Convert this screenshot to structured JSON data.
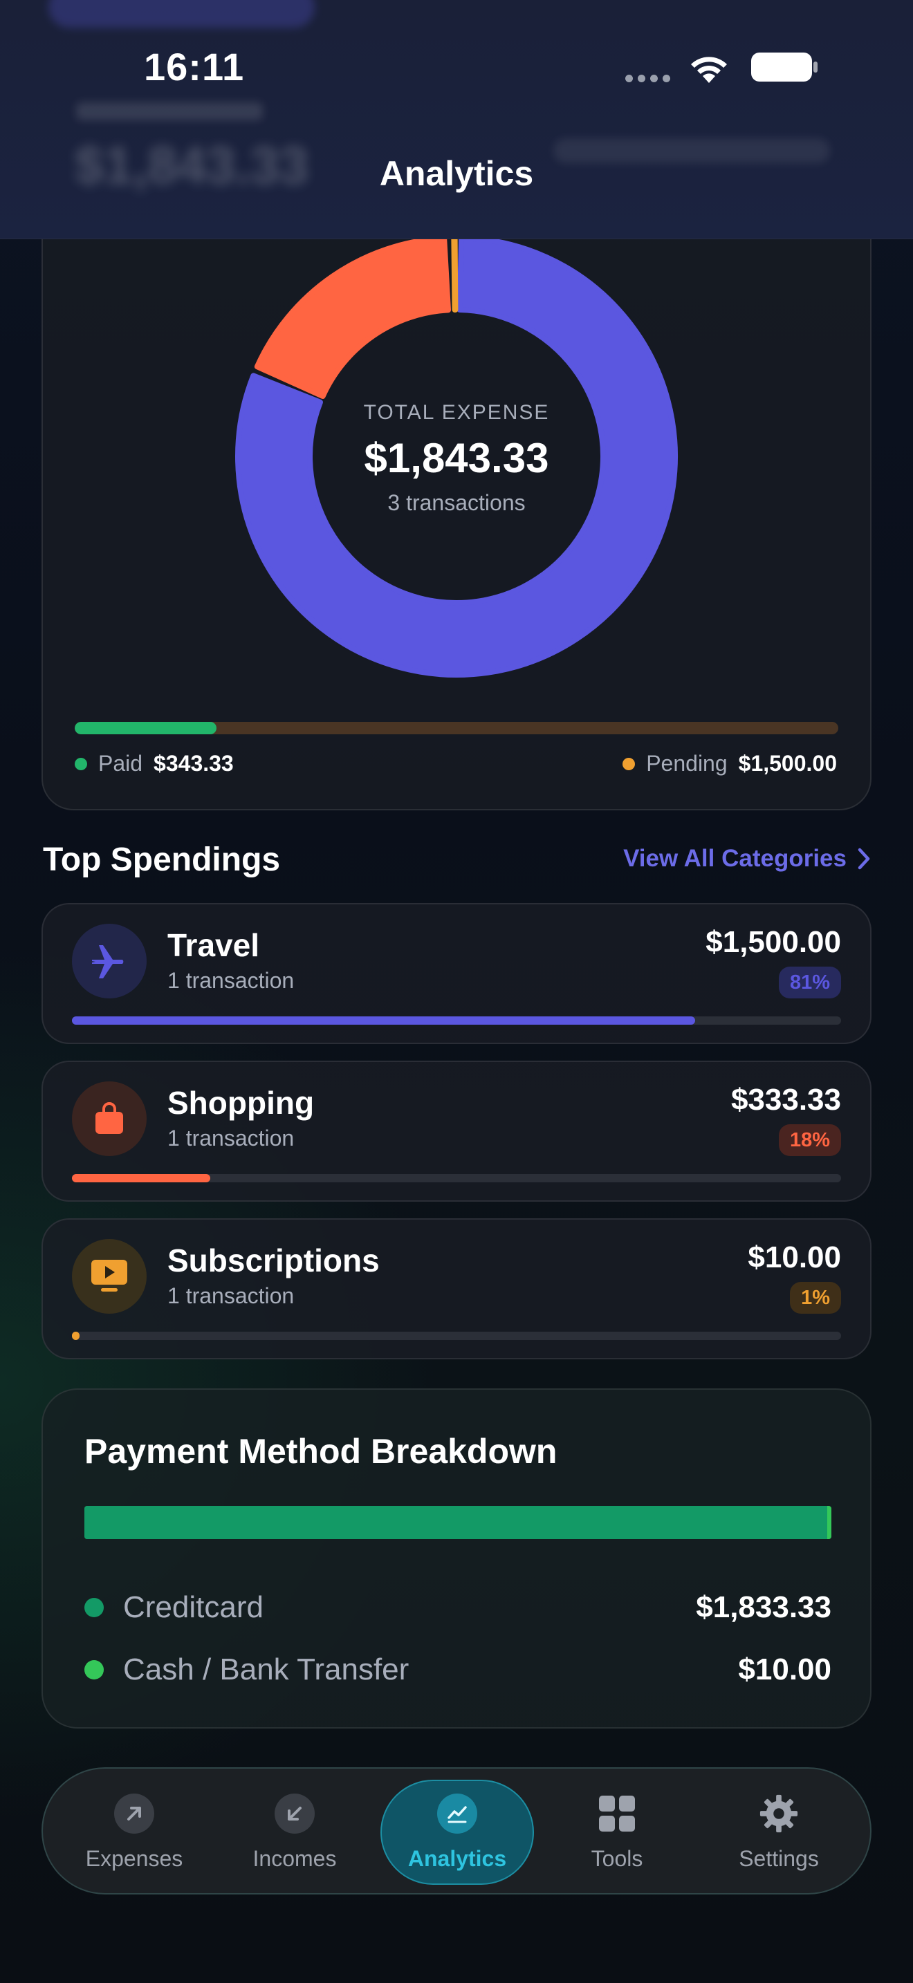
{
  "status": {
    "time": "16:11"
  },
  "header": {
    "title": "Analytics"
  },
  "summary": {
    "label": "TOTAL EXPENSE",
    "amount": "$1,843.33",
    "transactions": "3 transactions",
    "paid_label": "Paid",
    "paid_value": "$343.33",
    "pending_label": "Pending",
    "pending_value": "$1,500.00",
    "paid_fraction": 0.186,
    "colors": {
      "paid": "#22b56a",
      "pending": "#f0a030"
    }
  },
  "chart_data": {
    "type": "pie",
    "title": "",
    "categories": [
      "Travel",
      "Shopping",
      "Subscriptions"
    ],
    "values": [
      1500.0,
      333.33,
      10.0
    ],
    "colors": [
      "#5b57e0",
      "#ff6542",
      "#f0a030"
    ]
  },
  "top_spendings": {
    "title": "Top Spendings",
    "view_all": "View All Categories",
    "items": [
      {
        "name": "Travel",
        "count": "1 transaction",
        "amount": "$1,500.00",
        "percent": "81%",
        "fraction": 0.81,
        "icon": "airplane-icon",
        "color": "#5b57e0",
        "badge_bg": "#272a5e",
        "icon_bg": "#22264a"
      },
      {
        "name": "Shopping",
        "count": "1 transaction",
        "amount": "$333.33",
        "percent": "18%",
        "fraction": 0.18,
        "icon": "shopping-bag-icon",
        "color": "#ff6542",
        "badge_bg": "#4a2420",
        "icon_bg": "#3a2420"
      },
      {
        "name": "Subscriptions",
        "count": "1 transaction",
        "amount": "$10.00",
        "percent": "1%",
        "fraction": 0.01,
        "icon": "play-screen-icon",
        "color": "#f0a030",
        "badge_bg": "#3f2f18",
        "icon_bg": "#38301c"
      }
    ]
  },
  "payment": {
    "title": "Payment Method Breakdown",
    "methods": [
      {
        "name": "Creditcard",
        "value": "$1,833.33",
        "fraction": 0.9946,
        "color": "#139a66"
      },
      {
        "name": "Cash / Bank Transfer",
        "value": "$10.00",
        "fraction": 0.0054,
        "color": "#34c759"
      }
    ]
  },
  "tabs": [
    {
      "label": "Expenses",
      "icon": "arrow-up-right-icon",
      "active": false
    },
    {
      "label": "Incomes",
      "icon": "arrow-down-left-icon",
      "active": false
    },
    {
      "label": "Analytics",
      "icon": "chart-icon",
      "active": true
    },
    {
      "label": "Tools",
      "icon": "grid-icon",
      "active": false
    },
    {
      "label": "Settings",
      "icon": "gear-icon",
      "active": false
    }
  ]
}
